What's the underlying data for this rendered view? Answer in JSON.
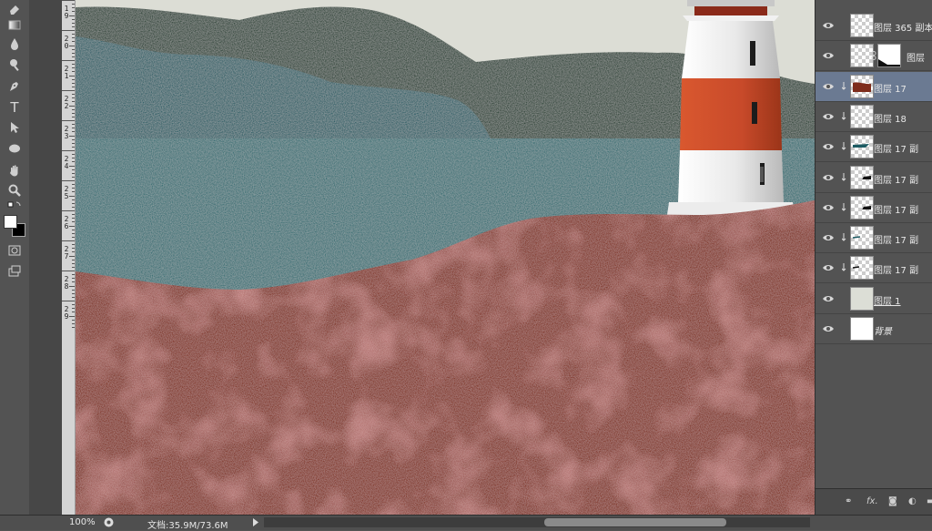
{
  "toolbar": {
    "tools": [
      "eraser-tool",
      "gradient-tool",
      "blur-tool",
      "dodge-tool",
      "pen-tool",
      "type-tool",
      "path-selection-tool",
      "ellipse-tool",
      "hand-tool",
      "zoom-tool",
      "swap-colors",
      "foreground-background-color",
      "quick-mask",
      "screen-mode"
    ],
    "type_glyph": "T"
  },
  "ruler": {
    "labels": [
      "1\n9",
      "2\n0",
      "2\n1",
      "2\n2",
      "2\n3",
      "2\n4",
      "2\n5",
      "2\n6",
      "2\n7",
      "2\n8",
      "2\n9"
    ]
  },
  "layers": {
    "items": [
      {
        "name": "图层 365 副本",
        "thumb": "transparent",
        "clipped": false,
        "selected": false
      },
      {
        "name": "图层",
        "thumb": "transparent",
        "clipped": false,
        "selected": false,
        "has_mask": true
      },
      {
        "name": "图层 17",
        "thumb": "rust-shape",
        "clipped": true,
        "selected": true
      },
      {
        "name": "图层 18",
        "thumb": "transparent",
        "clipped": true,
        "selected": false
      },
      {
        "name": "图层 17 副",
        "thumb": "teal-shape",
        "clipped": true,
        "selected": false
      },
      {
        "name": "图层 17 副",
        "thumb": "dark-shape",
        "clipped": true,
        "selected": false
      },
      {
        "name": "图层 17 副",
        "thumb": "dark-shape",
        "clipped": true,
        "selected": false
      },
      {
        "name": "图层 17 副",
        "thumb": "teal-line",
        "clipped": true,
        "selected": false
      },
      {
        "name": "图层 17 副",
        "thumb": "dark-line",
        "clipped": true,
        "selected": false
      },
      {
        "name": "图层 1",
        "thumb": "cream",
        "clipped": false,
        "selected": false
      },
      {
        "name": "背景",
        "thumb": "white",
        "clipped": false,
        "selected": false
      }
    ],
    "footer_icons": [
      "link-icon",
      "fx-icon",
      "mask-icon",
      "adjustment-icon",
      "folder-icon"
    ],
    "footer_fx": "fx."
  },
  "status": {
    "zoom": "100%",
    "doc": "文档:35.9M/73.6M"
  },
  "colors": {
    "sky": "#dcddd5",
    "dark_mountain": "#1f3a2b",
    "teal_hill": "#1c5a62",
    "sea": "#2b6b70",
    "rust": "#7e2d1c",
    "lighthouse_red": "#c84a2a",
    "selected_layer": "#6b7a92"
  }
}
